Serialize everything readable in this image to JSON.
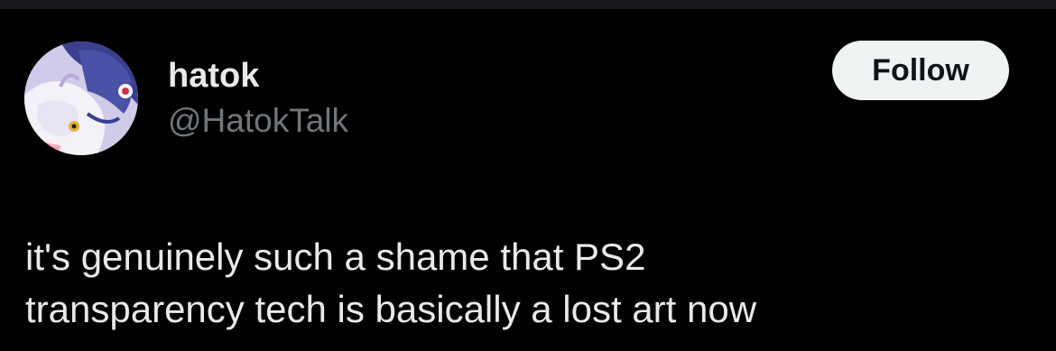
{
  "tweet": {
    "author": {
      "display_name": "hatok",
      "handle": "@HatokTalk"
    },
    "follow_label": "Follow",
    "text_lines": [
      "it's genuinely such a shame that PS2",
      "transparency tech is basically a lost art now"
    ]
  },
  "colors": {
    "background": "#000000",
    "primary_text": "#e7e9ea",
    "secondary_text": "#71767b",
    "follow_button_bg": "#eff3f4",
    "follow_button_text": "#0f1419"
  }
}
